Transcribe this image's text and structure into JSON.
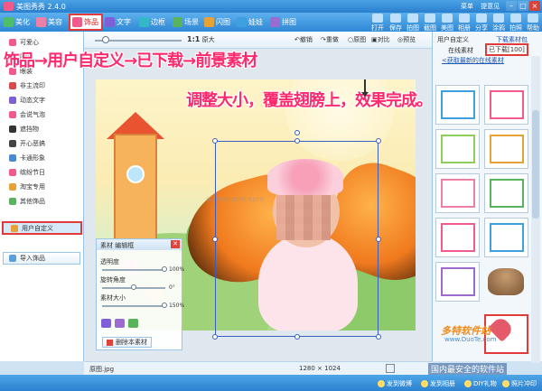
{
  "app": {
    "title": "美图秀秀 2.4.0",
    "links": [
      "菜单",
      "提意见"
    ]
  },
  "tabs": [
    {
      "label": "美化",
      "color": "#4dbf6a"
    },
    {
      "label": "美容",
      "color": "#f07fa7"
    },
    {
      "label": "饰品",
      "color": "#f25a8a"
    },
    {
      "label": "文字",
      "color": "#7e5fd8"
    },
    {
      "label": "边框",
      "color": "#33b7c9"
    },
    {
      "label": "场景",
      "color": "#58b35c"
    },
    {
      "label": "闪图",
      "color": "#e6a235"
    },
    {
      "label": "娃娃",
      "color": "#3ea0e0"
    },
    {
      "label": "拼图",
      "color": "#9c6bd0"
    }
  ],
  "active_tab": "饰品",
  "toolbar": [
    "打开",
    "保存",
    "拍图",
    "截图",
    "美图",
    "相册",
    "分享",
    "涂鸦",
    "拍照",
    "帮助"
  ],
  "categories": [
    {
      "label": "可爱心",
      "color": "#f25a8a"
    },
    {
      "label": "配饰",
      "color": "#f78f3f"
    },
    {
      "label": "眼装",
      "color": "#f25a8a"
    },
    {
      "label": "非主流印",
      "color": "#d94c4c"
    },
    {
      "label": "动态文字",
      "color": "#7e5fd8"
    },
    {
      "label": "会说气泡",
      "color": "#f25a8a"
    },
    {
      "label": "遮挡物",
      "color": "#333333"
    },
    {
      "label": "开心恶搞",
      "color": "#444444"
    },
    {
      "label": "卡通形象",
      "color": "#4a8ad2"
    },
    {
      "label": "缤纷节日",
      "color": "#f25a8a"
    },
    {
      "label": "淘宝专用",
      "color": "#e6a235"
    },
    {
      "label": "其他饰品",
      "color": "#58b35c"
    },
    {
      "label": "用户自定义",
      "color": "#e6a235"
    }
  ],
  "import_label": "导入饰品",
  "canvas_toolbar": {
    "zoom_label": "1:1",
    "zoom_text": "原大",
    "buttons": [
      "撤销",
      "重做",
      "原图",
      "对比",
      "预览"
    ]
  },
  "annotations": {
    "steps": "饰品→用户自定义→已下载→前景素材",
    "instruction": "调整大小，覆盖翅膀上，效果完成。"
  },
  "watermark": "www.duote.com",
  "material_panel": {
    "tabs": "素材 编辑框",
    "close": "✕",
    "rows": [
      {
        "label": "透明度",
        "value": "100%",
        "level": 1.0
      },
      {
        "label": "旋转角度",
        "value": "0°",
        "level": 0.5
      },
      {
        "label": "素材大小",
        "value": "150%",
        "level": 1.0
      }
    ],
    "delete_label": "删除本素材"
  },
  "status": {
    "filename": "原图.jpg",
    "dimensions": "1280 × 1024"
  },
  "right_panel": {
    "title": "用户自定义",
    "tab_online_top": "下载素材包",
    "tab_downloaded": "已下载[100]",
    "tab_online": "在线素材",
    "fetch_link": "<获取最新的在线素材",
    "thumb_colors": [
      "#3ea0e0",
      "#f25a8a",
      "#8ccf5a",
      "#e6a235",
      "#f07fa7",
      "#58b35c",
      "#f25a8a",
      "#3ea0e0",
      "#9c6bd0",
      "#f07fa7",
      "#e6a235",
      "#58b35c"
    ]
  },
  "branding": {
    "logo": "多特软件站",
    "url": "www.DuoTe.com",
    "slogan": "国内最安全的软件站"
  },
  "bottom_bar": [
    "发到微博",
    "发到相册",
    "DIY礼物",
    "照片冲印"
  ]
}
